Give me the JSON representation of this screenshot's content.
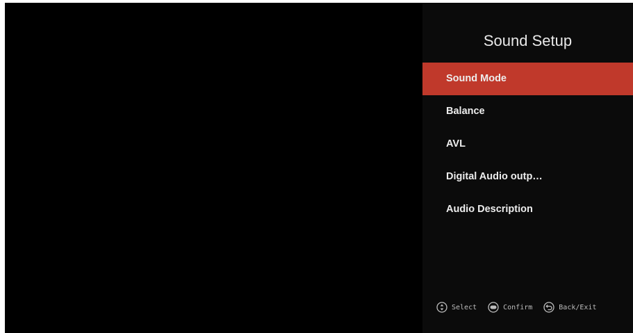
{
  "title": "Sound Setup",
  "accent_color": "#c0392b",
  "menu": {
    "selected_index": 0,
    "items": [
      {
        "label": "Sound Mode"
      },
      {
        "label": "Balance"
      },
      {
        "label": "AVL"
      },
      {
        "label": "Digital Audio outp…"
      },
      {
        "label": "Audio Description"
      }
    ]
  },
  "hints": {
    "select": {
      "icon": "updown-icon",
      "label": "Select"
    },
    "confirm": {
      "icon": "ok-icon",
      "label": "Confirm"
    },
    "back": {
      "icon": "back-icon",
      "label": "Back/Exit"
    }
  }
}
